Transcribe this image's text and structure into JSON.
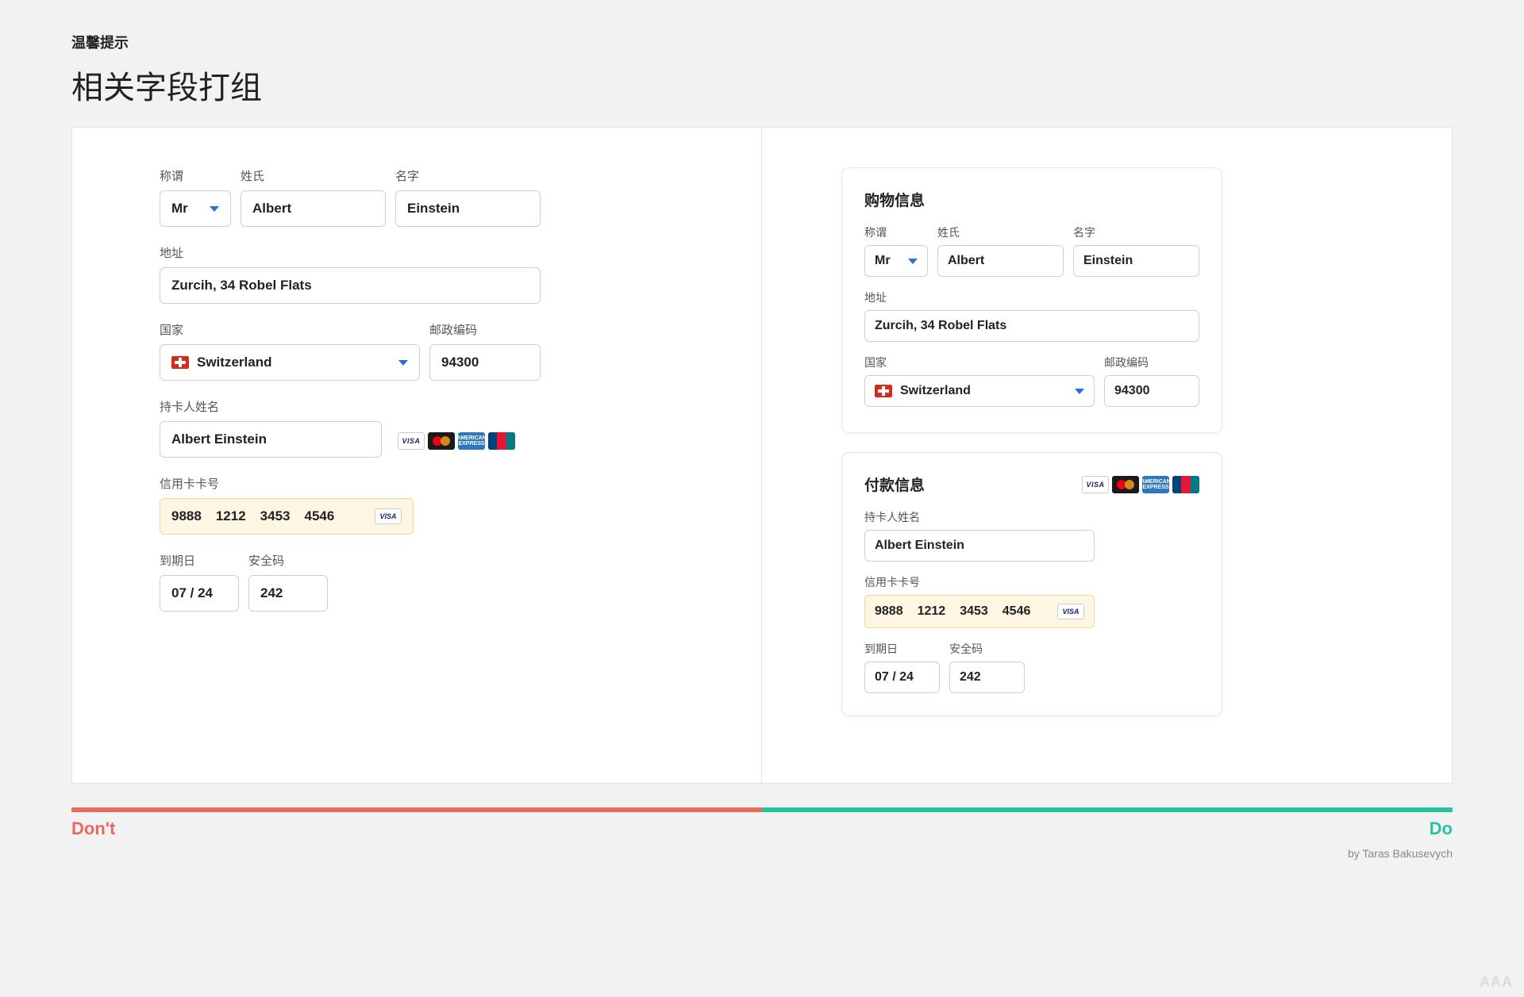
{
  "header": {
    "kicker": "温馨提示",
    "title": "相关字段打组"
  },
  "labels": {
    "title": "称谓",
    "lastName": "姓氏",
    "firstName": "名字",
    "address": "地址",
    "country": "国家",
    "zip": "邮政编码",
    "cardholder": "持卡人姓名",
    "cardNumber": "信用卡卡号",
    "expiry": "到期日",
    "cvv": "安全码"
  },
  "sections": {
    "shopping": "购物信息",
    "payment": "付款信息"
  },
  "values": {
    "salutation": "Mr",
    "lastName": "Albert",
    "firstName": "Einstein",
    "address": "Zurcih, 34 Robel Flats",
    "country": "Switzerland",
    "zip": "94300",
    "cardholder": "Albert Einstein",
    "cardGroups": [
      "9888",
      "1212",
      "3453",
      "4546"
    ],
    "expiry": "07 / 24",
    "cvv": "242"
  },
  "cardBrands": {
    "visa": "VISA",
    "amex": "AMERICAN EXPRESS"
  },
  "footer": {
    "dont": "Don't",
    "do": "Do",
    "credit": "by Taras Bakusevych",
    "watermark": "AAA"
  }
}
